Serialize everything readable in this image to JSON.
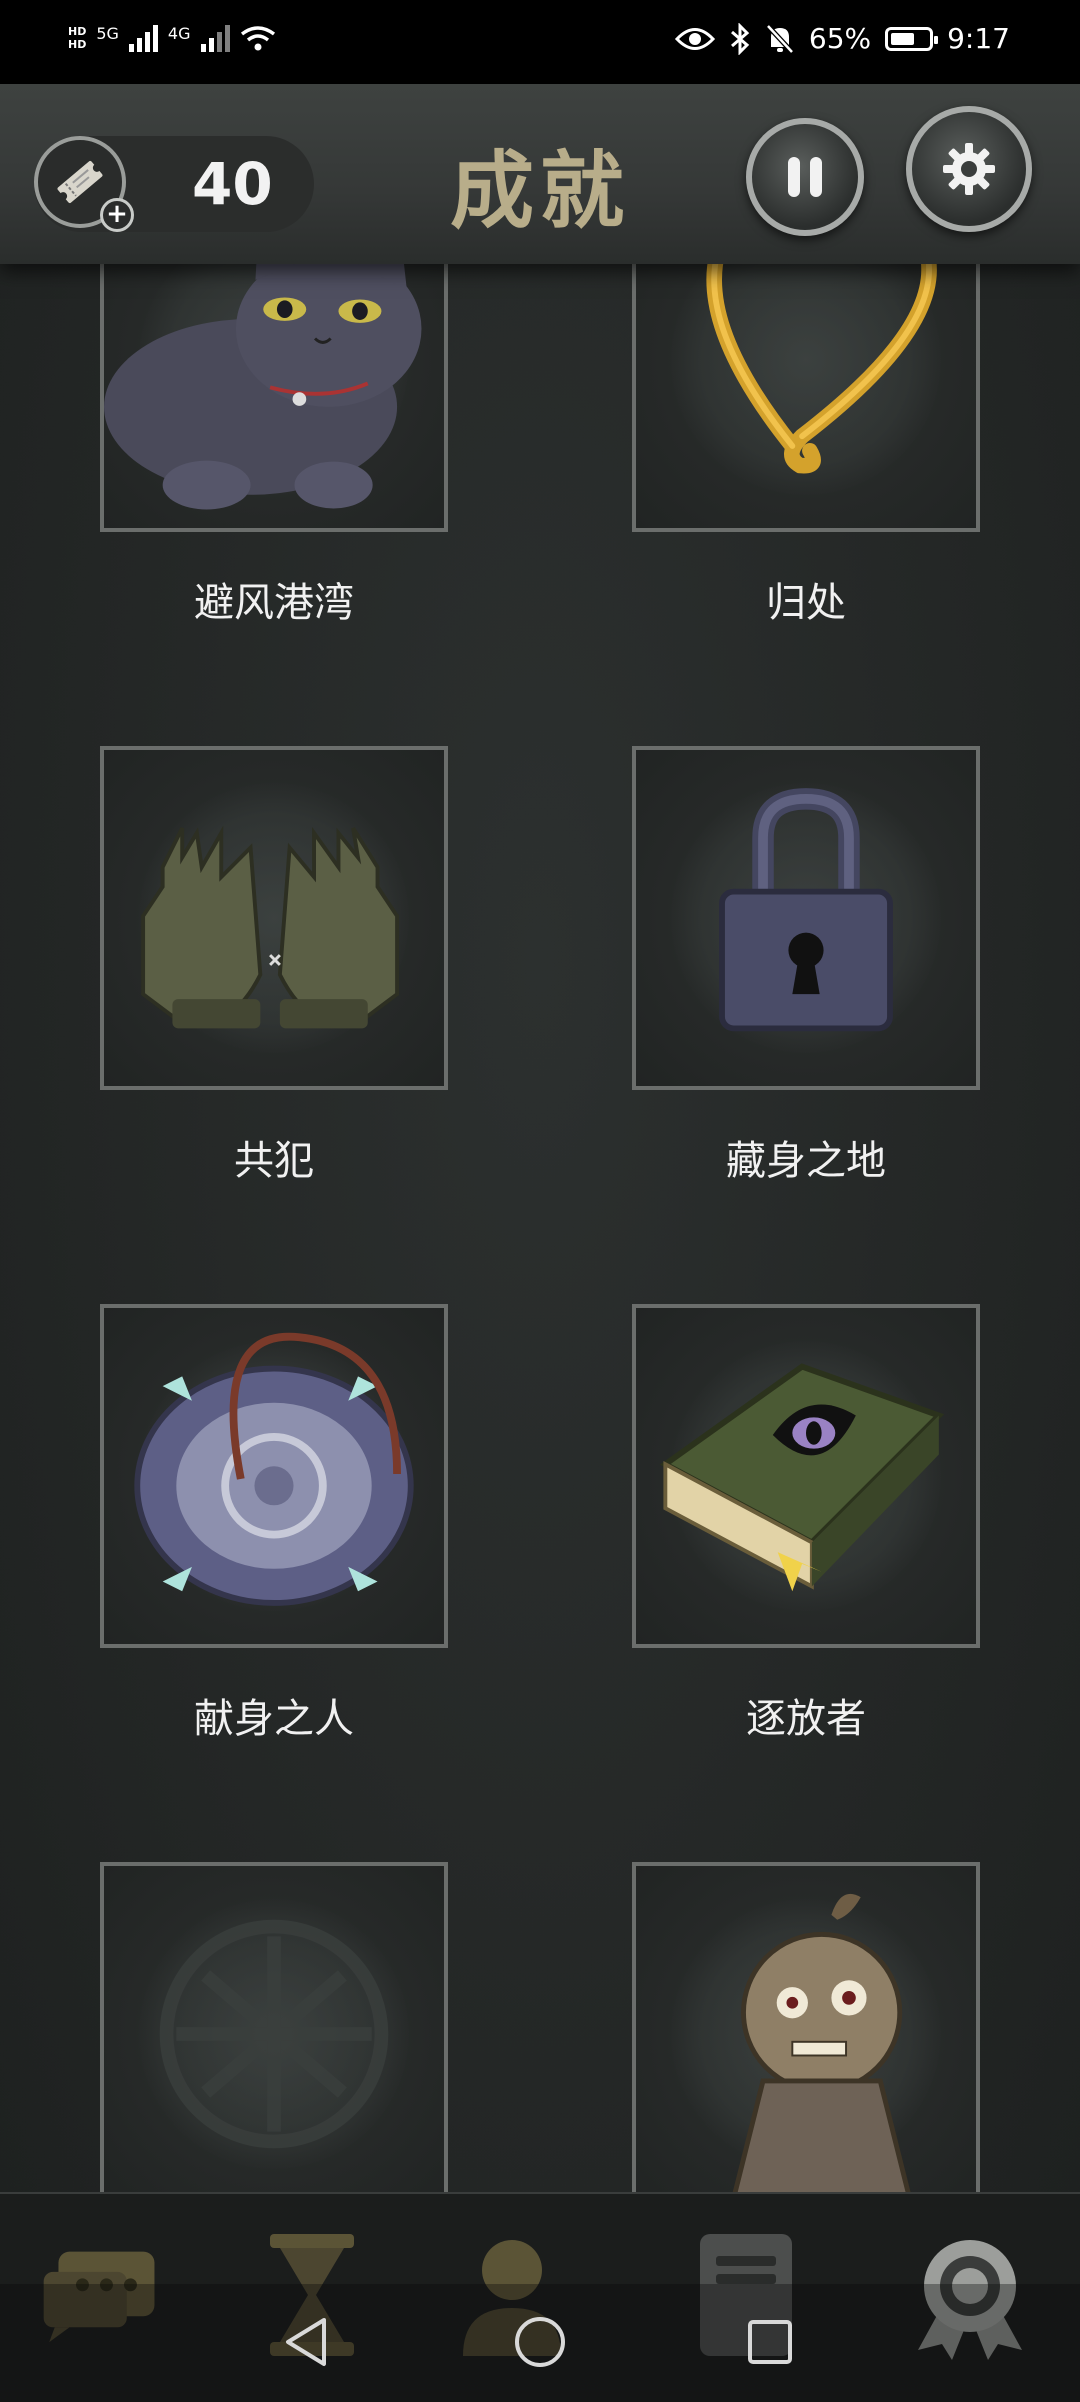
{
  "status_bar": {
    "network_1": "5G",
    "network_2": "4G",
    "battery": "65%",
    "time": "9:17",
    "hd_labels": [
      "HD",
      "HD"
    ]
  },
  "header": {
    "ticket_count": "40",
    "title": "成就",
    "pause_icon": "pause-icon",
    "settings_icon": "gear-icon",
    "ticket_icon": "ticket-icon"
  },
  "achievements": [
    {
      "label": "避风港湾",
      "icon": "cat-icon"
    },
    {
      "label": "归处",
      "icon": "golden-heart-icon"
    },
    {
      "label": "共犯",
      "icon": "gloves-icon"
    },
    {
      "label": "藏身之地",
      "icon": "padlock-icon"
    },
    {
      "label": "献身之人",
      "icon": "amulet-icon"
    },
    {
      "label": "逐放者",
      "icon": "eye-book-icon"
    },
    {
      "label": "",
      "icon": "locked-emblem-icon"
    },
    {
      "label": "",
      "icon": "teru-teru-doll-icon"
    }
  ],
  "bottom_nav": {
    "items": [
      "chat-icon",
      "hourglass-icon",
      "profile-icon",
      "phone-icon",
      "achievement-medal-icon"
    ],
    "system": [
      "back-icon",
      "home-icon",
      "recents-icon"
    ]
  },
  "colors": {
    "title": "#b8ad8a",
    "background": "#252827",
    "card_border": "#6b6e6c"
  }
}
